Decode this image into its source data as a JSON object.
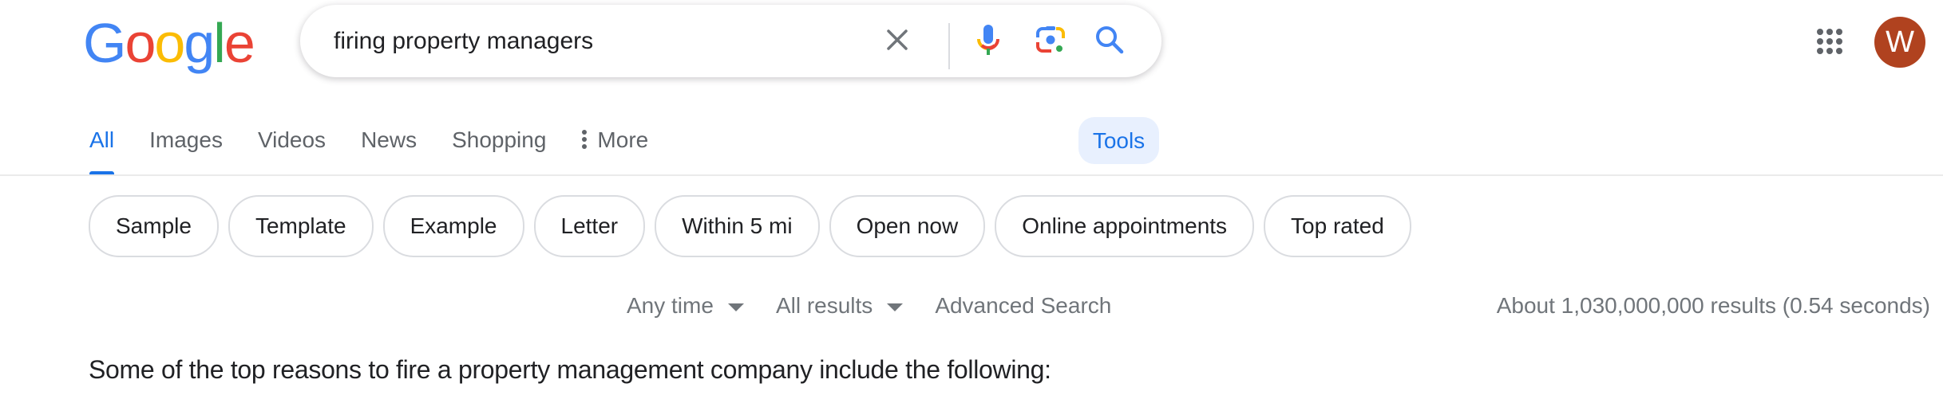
{
  "header": {
    "logo": {
      "letters": [
        "G",
        "o",
        "o",
        "g",
        "l",
        "e"
      ],
      "colors": [
        "#4285f4",
        "#ea4335",
        "#fbbc05",
        "#4285f4",
        "#34a853",
        "#ea4335"
      ]
    },
    "search": {
      "value": "firing property managers",
      "clear_icon": "close-icon",
      "voice_icon": "microphone-icon",
      "lens_icon": "camera-lens-icon",
      "search_icon": "magnifier-icon"
    },
    "apps_icon": "apps-grid-icon",
    "avatar": {
      "initial": "W",
      "color": "#b0421f"
    }
  },
  "tabs": [
    {
      "label": "All",
      "active": true
    },
    {
      "label": "Images"
    },
    {
      "label": "Videos"
    },
    {
      "label": "News"
    },
    {
      "label": "Shopping"
    },
    {
      "label": "More",
      "icon": "vertical-dots-icon"
    }
  ],
  "tools_label": "Tools",
  "chips": [
    "Sample",
    "Template",
    "Example",
    "Letter",
    "Within 5 mi",
    "Open now",
    "Online appointments",
    "Top rated"
  ],
  "filters": {
    "time": "Any time",
    "results": "All results",
    "advanced": "Advanced Search"
  },
  "result_stats": "About 1,030,000,000 results (0.54 seconds)",
  "snippet": "Some of the top reasons to fire a property management company include the following:",
  "colors": {
    "accent": "#1a73e8",
    "tools_bg": "#e8f0fe",
    "muted_text": "#70757a",
    "tab_text": "#5f6368"
  }
}
